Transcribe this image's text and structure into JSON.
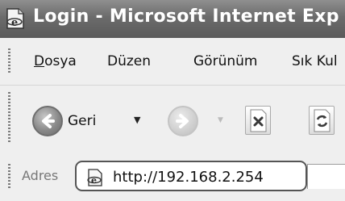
{
  "window": {
    "title": "Login - Microsoft Internet Exp",
    "icon": "ie-page-icon"
  },
  "menu": {
    "items": [
      {
        "label": "Dosya",
        "mnemonic": "D"
      },
      {
        "label": "Düzen",
        "mnemonic": "z"
      },
      {
        "label": "Görünüm",
        "mnemonic": "G"
      },
      {
        "label": "Sık Kul",
        "mnemonic": "S"
      }
    ]
  },
  "toolbar": {
    "back_label": "Geri",
    "back_icon": "back-arrow-icon",
    "forward_icon": "forward-arrow-icon",
    "stop_icon": "stop-icon",
    "refresh_icon": "refresh-icon"
  },
  "address": {
    "label": "Adres",
    "url": "http://192.168.2.254",
    "page_icon": "ie-page-icon"
  }
}
